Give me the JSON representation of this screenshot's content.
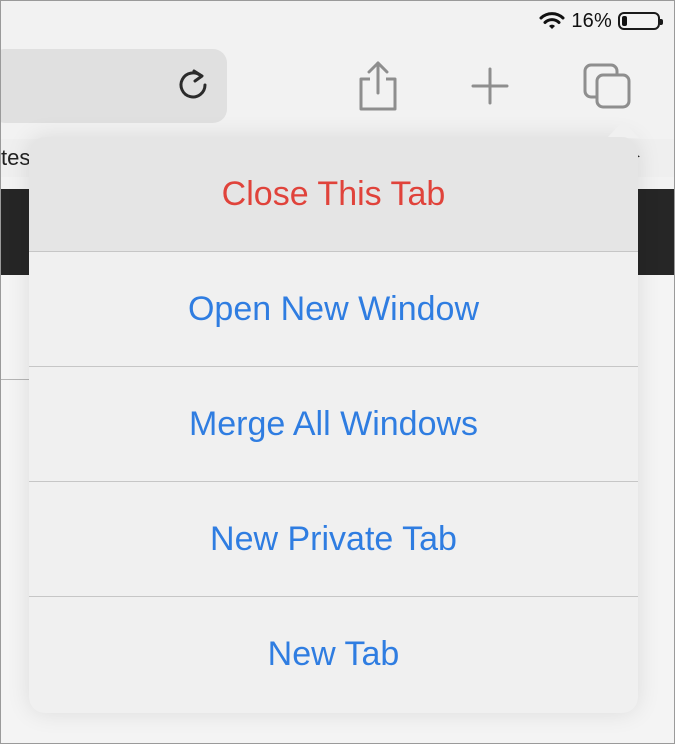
{
  "status_bar": {
    "battery_percent_text": "16%",
    "battery_level": 0.16,
    "icons": [
      "wifi-icon",
      "battery-icon"
    ]
  },
  "toolbar": {
    "icons": [
      "reload-icon",
      "share-icon",
      "plus-icon",
      "tabs-icon"
    ]
  },
  "page": {
    "bookmark_partial_text": "tes"
  },
  "popover_menu": {
    "items": [
      {
        "label": "Close This Tab",
        "style": "destructive"
      },
      {
        "label": "Open New Window",
        "style": "default"
      },
      {
        "label": "Merge All Windows",
        "style": "default"
      },
      {
        "label": "New Private Tab",
        "style": "default"
      },
      {
        "label": "New Tab",
        "style": "default"
      }
    ]
  },
  "colors": {
    "destructive": "#e0433b",
    "action_blue": "#2f7de1"
  }
}
